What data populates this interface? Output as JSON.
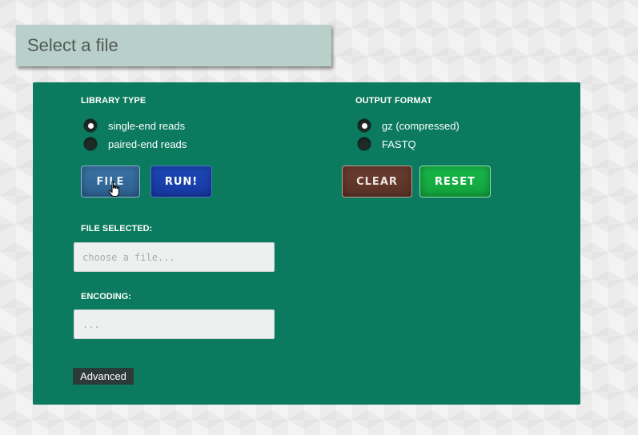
{
  "header": {
    "title": "Select a file"
  },
  "library_type": {
    "heading": "LIBRARY TYPE",
    "options": [
      {
        "label": "single-end reads",
        "checked": true
      },
      {
        "label": "paired-end reads",
        "checked": false
      }
    ]
  },
  "output_format": {
    "heading": "OUTPUT FORMAT",
    "options": [
      {
        "label": "gz (compressed)",
        "checked": true
      },
      {
        "label": "FASTQ",
        "checked": false
      }
    ]
  },
  "buttons": {
    "file": "FILE",
    "run": "RUN!",
    "clear": "CLEAR",
    "reset": "RESET"
  },
  "file_selected": {
    "label": "FILE SELECTED:",
    "placeholder": "choose a file...",
    "value": ""
  },
  "encoding": {
    "label": "ENCODING:",
    "placeholder": "...",
    "value": ""
  },
  "advanced": {
    "label": "Advanced"
  },
  "colors": {
    "panel": "#0b7a5e",
    "title_bar": "#b9cfc9",
    "file_button": "#3b75a8",
    "run_button": "#1d49b8",
    "clear_button": "#6b3e31",
    "reset_button": "#18b94a",
    "advanced_button": "#2d3b38"
  },
  "icons": {
    "cursor": "hand-pointer-icon"
  }
}
